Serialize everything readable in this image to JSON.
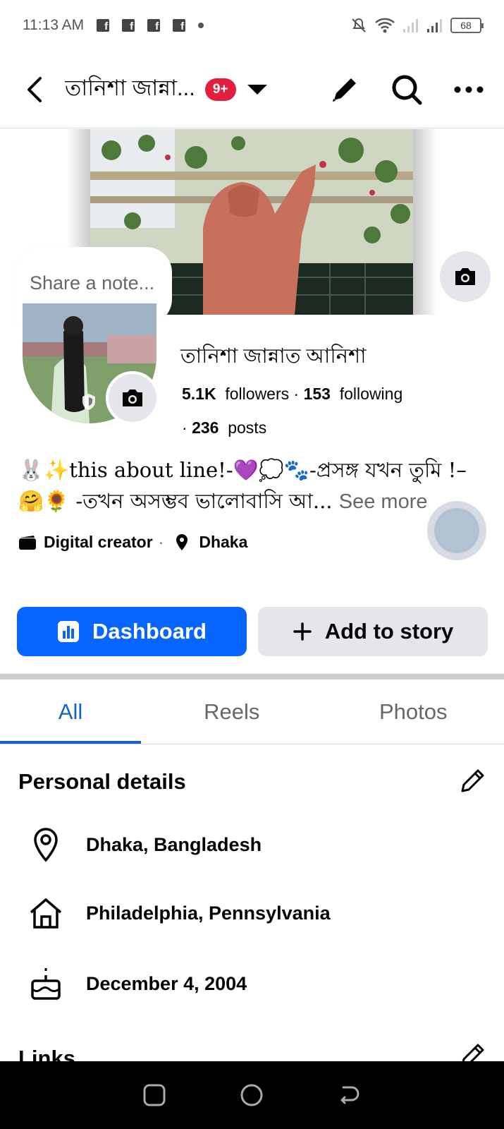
{
  "status_bar": {
    "time": "11:13 AM",
    "app_icons": [
      "f",
      "f",
      "f",
      "f"
    ],
    "battery": "68"
  },
  "app_bar": {
    "title": "তানিশা জান্না...",
    "badge": "9+"
  },
  "note": {
    "placeholder": "Share a note..."
  },
  "profile": {
    "name": "তানিশা জান্নাত আনিশা",
    "followers_count": "5.1K",
    "followers_label": "followers",
    "following_count": "153",
    "following_label": "following",
    "posts_count": "236",
    "posts_label": "posts",
    "bio": "🐰✨this about line!-💜💭🐾-প্রসঙ্গ যখন তুমি !–🤗🌻 -তখন অসম্ভব ভালোবাসি আ...",
    "see_more": "See more",
    "category": "Digital creator",
    "location": "Dhaka"
  },
  "buttons": {
    "dashboard": "Dashboard",
    "add_story": "Add to story"
  },
  "tabs": [
    "All",
    "Reels",
    "Photos"
  ],
  "personal_details": {
    "title": "Personal details",
    "items": [
      {
        "icon": "location-pin-icon",
        "text": "Dhaka, Bangladesh"
      },
      {
        "icon": "home-icon",
        "text": "Philadelphia, Pennsylvania"
      },
      {
        "icon": "birthday-cake-icon",
        "text": "December 4, 2004"
      }
    ]
  },
  "links": {
    "title": "Links"
  },
  "colors": {
    "primary": "#0866ff",
    "badge": "#e41e3f",
    "tab_active": "#1565c0",
    "secondary_button": "#e4e6eb"
  }
}
